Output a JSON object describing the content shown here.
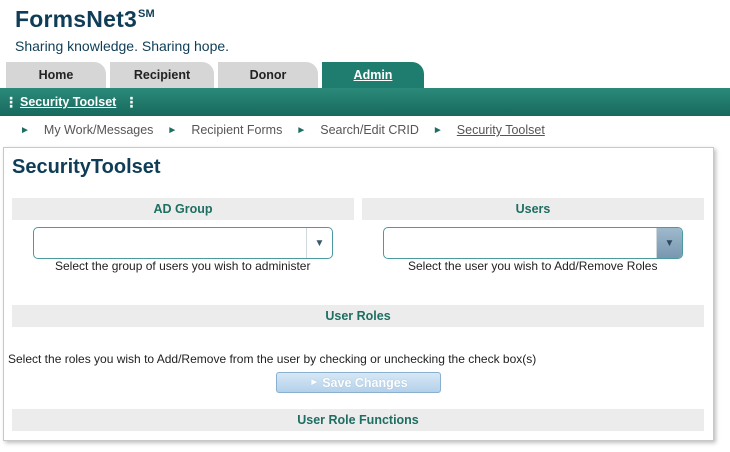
{
  "brand": {
    "title": "FormsNet3",
    "mark": "SM",
    "tagline": "Sharing knowledge. Sharing hope."
  },
  "tabs": [
    {
      "label": "Home"
    },
    {
      "label": "Recipient"
    },
    {
      "label": "Donor"
    },
    {
      "label": "Admin",
      "active": true
    }
  ],
  "toolbar": {
    "dots": "⋮",
    "link": "Security Toolset"
  },
  "breadcrumb": {
    "arrow": "►",
    "items": [
      "My Work/Messages",
      "Recipient Forms",
      "Search/Edit CRID",
      "Security Toolset"
    ]
  },
  "page": {
    "title": "SecurityToolset",
    "ad_group": {
      "header": "AD Group",
      "value": "",
      "hint": "Select the group of users you wish to administer"
    },
    "users": {
      "header": "Users",
      "value": "",
      "hint": "Select the user you wish to Add/Remove Roles"
    },
    "user_roles": {
      "header": "User Roles",
      "instructions": "Select the roles you wish to Add/Remove from the user by checking or unchecking the check box(s)"
    },
    "save": {
      "icon": "►",
      "label": "Save Changes"
    },
    "user_role_functions": {
      "header": "User Role Functions"
    },
    "dropdown_arrow": "▼"
  },
  "colors": {
    "brand": "#0f3d57",
    "accent": "#1e7d6e",
    "section_text": "#1e6e62",
    "section_bg": "#ececec"
  }
}
